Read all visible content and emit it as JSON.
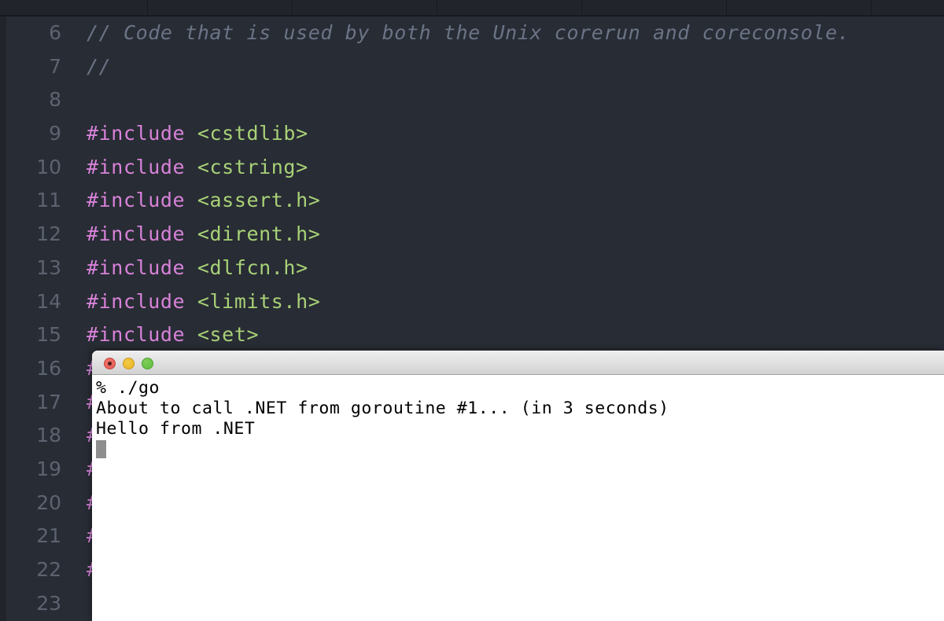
{
  "window": {
    "app": "code-editor-with-terminal-overlay"
  },
  "tab_bar": {
    "tab_count": 7,
    "tabs": [
      {
        "label": ""
      },
      {
        "label": ""
      },
      {
        "label": ""
      },
      {
        "label": ""
      },
      {
        "label": ""
      },
      {
        "label": ""
      },
      {
        "label": ""
      }
    ]
  },
  "editor": {
    "language": "cpp",
    "colors": {
      "background": "#282c34",
      "gutter_text": "#5c6370",
      "comment": "#6b7486",
      "preprocessor": "#d782d9",
      "string_include": "#a8d177",
      "tab_bar_background": "#21252b"
    },
    "lines": [
      {
        "number": "6",
        "segments": [
          {
            "text": "// Code that is used by both the Unix corerun and coreconsole.",
            "token": "comment"
          }
        ]
      },
      {
        "number": "7",
        "segments": [
          {
            "text": "//",
            "token": "comment"
          }
        ]
      },
      {
        "number": "8",
        "segments": [
          {
            "text": "",
            "token": "plain"
          }
        ]
      },
      {
        "number": "9",
        "segments": [
          {
            "text": "#include ",
            "token": "pre"
          },
          {
            "text": "<cstdlib>",
            "token": "str"
          }
        ]
      },
      {
        "number": "10",
        "segments": [
          {
            "text": "#include ",
            "token": "pre"
          },
          {
            "text": "<cstring>",
            "token": "str"
          }
        ]
      },
      {
        "number": "11",
        "segments": [
          {
            "text": "#include ",
            "token": "pre"
          },
          {
            "text": "<assert.h>",
            "token": "str"
          }
        ]
      },
      {
        "number": "12",
        "segments": [
          {
            "text": "#include ",
            "token": "pre"
          },
          {
            "text": "<dirent.h>",
            "token": "str"
          }
        ]
      },
      {
        "number": "13",
        "segments": [
          {
            "text": "#include ",
            "token": "pre"
          },
          {
            "text": "<dlfcn.h>",
            "token": "str"
          }
        ]
      },
      {
        "number": "14",
        "segments": [
          {
            "text": "#include ",
            "token": "pre"
          },
          {
            "text": "<limits.h>",
            "token": "str"
          }
        ]
      },
      {
        "number": "15",
        "segments": [
          {
            "text": "#include ",
            "token": "pre"
          },
          {
            "text": "<set>",
            "token": "str"
          }
        ]
      },
      {
        "number": "16",
        "segments": [
          {
            "text": "#",
            "token": "pre"
          }
        ]
      },
      {
        "number": "17",
        "segments": [
          {
            "text": "#",
            "token": "pre"
          }
        ]
      },
      {
        "number": "18",
        "segments": [
          {
            "text": "#",
            "token": "pre"
          }
        ]
      },
      {
        "number": "19",
        "segments": [
          {
            "text": "#",
            "token": "pre"
          }
        ]
      },
      {
        "number": "20",
        "segments": [
          {
            "text": "#",
            "token": "pre"
          }
        ]
      },
      {
        "number": "21",
        "segments": [
          {
            "text": "#",
            "token": "pre"
          }
        ]
      },
      {
        "number": "22",
        "segments": [
          {
            "text": "#",
            "token": "pre"
          }
        ]
      },
      {
        "number": "23",
        "segments": [
          {
            "text": "",
            "token": "plain"
          }
        ]
      }
    ]
  },
  "terminal": {
    "title": "",
    "traffic_lights": {
      "close": {
        "name": "close-button",
        "color": "#e05a52"
      },
      "minimize": {
        "name": "minimize-button",
        "color": "#e8b420"
      },
      "maximize": {
        "name": "maximize-button",
        "color": "#5fbd3e"
      }
    },
    "output": [
      "% ./go",
      "About to call .NET from goroutine #1... (in 3 seconds)",
      "Hello from .NET"
    ],
    "cursor": "block",
    "colors": {
      "background": "#ffffff",
      "text": "#000000",
      "cursor": "#8e8e8e",
      "titlebar_top": "#ededed",
      "titlebar_bottom": "#d2d2d2"
    }
  }
}
